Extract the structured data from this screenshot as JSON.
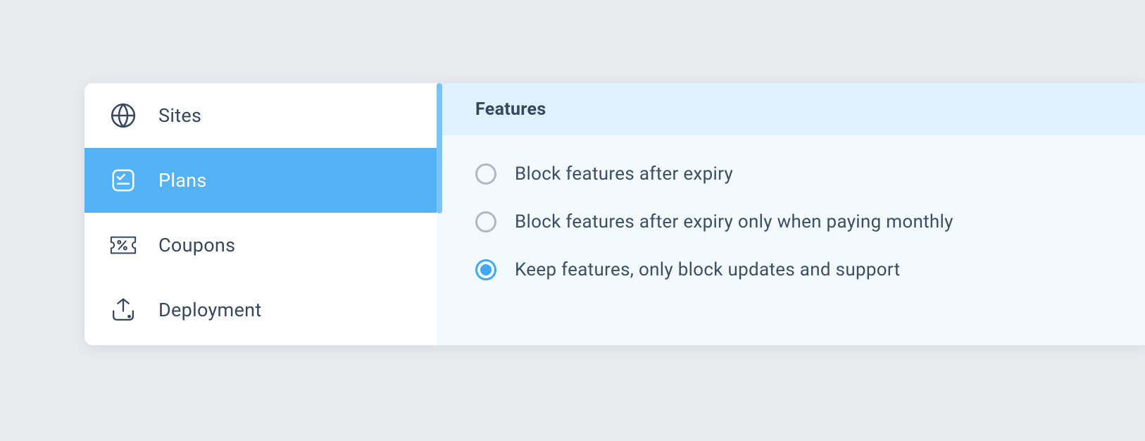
{
  "sidebar": {
    "items": [
      {
        "label": "Sites"
      },
      {
        "label": "Plans"
      },
      {
        "label": "Coupons"
      },
      {
        "label": "Deployment"
      }
    ]
  },
  "content": {
    "section_title": "Features",
    "options": [
      {
        "label": "Block features after expiry"
      },
      {
        "label": "Block features after expiry only when paying monthly"
      },
      {
        "label": "Keep features, only block updates and support"
      }
    ]
  }
}
